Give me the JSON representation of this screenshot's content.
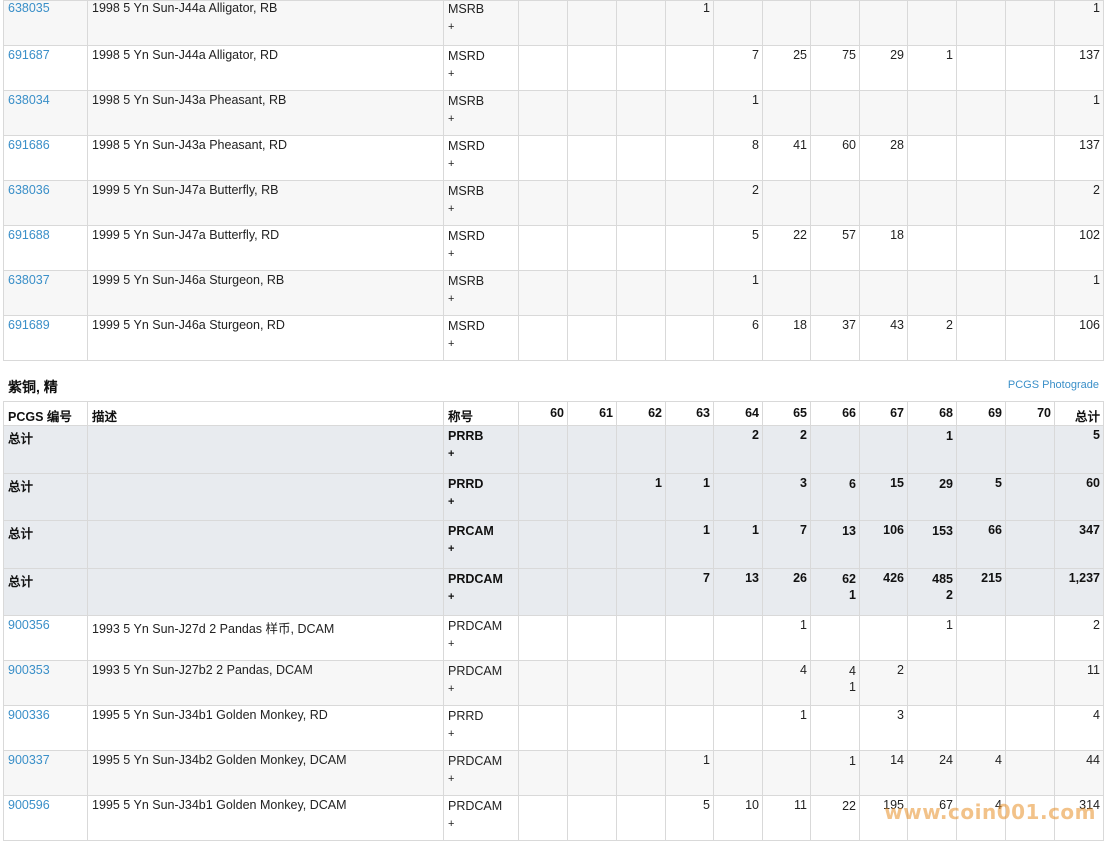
{
  "top_table": {
    "rows": [
      {
        "pcgs": "638035",
        "desc": "1998 5 Yn Sun-J44a Alligator, RB",
        "des": "MSRB",
        "plus": "+",
        "g60": "",
        "g61": "",
        "g62": "",
        "g63": "1",
        "g64": "",
        "g65": "",
        "g66": "",
        "g67": "",
        "g68": "",
        "g69": "",
        "g70": "",
        "total": "1"
      },
      {
        "pcgs": "691687",
        "desc": "1998 5 Yn Sun-J44a Alligator, RD",
        "des": "MSRD",
        "plus": "+",
        "g60": "",
        "g61": "",
        "g62": "",
        "g63": "",
        "g64": "7",
        "g65": "25",
        "g66": "75",
        "g67": "29",
        "g68": "1",
        "g69": "",
        "g70": "",
        "total": "137"
      },
      {
        "pcgs": "638034",
        "desc": "1998 5 Yn Sun-J43a Pheasant, RB",
        "des": "MSRB",
        "plus": "+",
        "g60": "",
        "g61": "",
        "g62": "",
        "g63": "",
        "g64": "1",
        "g65": "",
        "g66": "",
        "g67": "",
        "g68": "",
        "g69": "",
        "g70": "",
        "total": "1"
      },
      {
        "pcgs": "691686",
        "desc": "1998 5 Yn Sun-J43a Pheasant, RD",
        "des": "MSRD",
        "plus": "+",
        "g60": "",
        "g61": "",
        "g62": "",
        "g63": "",
        "g64": "8",
        "g65": "41",
        "g66": "60",
        "g67": "28",
        "g68": "",
        "g69": "",
        "g70": "",
        "total": "137"
      },
      {
        "pcgs": "638036",
        "desc": "1999 5 Yn Sun-J47a Butterfly, RB",
        "des": "MSRB",
        "plus": "+",
        "g60": "",
        "g61": "",
        "g62": "",
        "g63": "",
        "g64": "2",
        "g65": "",
        "g66": "",
        "g67": "",
        "g68": "",
        "g69": "",
        "g70": "",
        "total": "2"
      },
      {
        "pcgs": "691688",
        "desc": "1999 5 Yn Sun-J47a Butterfly, RD",
        "des": "MSRD",
        "plus": "+",
        "g60": "",
        "g61": "",
        "g62": "",
        "g63": "",
        "g64": "5",
        "g65": "22",
        "g66": "57",
        "g67": "18",
        "g68": "",
        "g69": "",
        "g70": "",
        "total": "102"
      },
      {
        "pcgs": "638037",
        "desc": "1999 5 Yn Sun-J46a Sturgeon, RB",
        "des": "MSRB",
        "plus": "+",
        "g60": "",
        "g61": "",
        "g62": "",
        "g63": "",
        "g64": "1",
        "g65": "",
        "g66": "",
        "g67": "",
        "g68": "",
        "g69": "",
        "g70": "",
        "total": "1"
      },
      {
        "pcgs": "691689",
        "desc": "1999 5 Yn Sun-J46a Sturgeon, RD",
        "des": "MSRD",
        "plus": "+",
        "g60": "",
        "g61": "",
        "g62": "",
        "g63": "",
        "g64": "6",
        "g65": "18",
        "g66": "37",
        "g67": "43",
        "g68": "2",
        "g69": "",
        "g70": "",
        "total": "106"
      }
    ]
  },
  "section": {
    "title": "紫铜, 精",
    "photograde_link": "PCGS Photograde"
  },
  "header": {
    "pcgs": "PCGS 编号",
    "desc": "描述",
    "des": "称号",
    "g60": "60",
    "g61": "61",
    "g62": "62",
    "g63": "63",
    "g64": "64",
    "g65": "65",
    "g66": "66",
    "g67": "67",
    "g68": "68",
    "g69": "69",
    "g70": "70",
    "total": "总计"
  },
  "totals": [
    {
      "label": "总计",
      "des": "PRRB",
      "plus": "+",
      "g60": "",
      "g61": "",
      "g62": "",
      "g63": "",
      "g64": "2",
      "g65": "2",
      "g66": "",
      "g66b": "",
      "g67": "",
      "g68": "1",
      "g68b": "",
      "g69": "",
      "g70": "",
      "total": "5"
    },
    {
      "label": "总计",
      "des": "PRRD",
      "plus": "+",
      "g60": "",
      "g61": "",
      "g62": "1",
      "g63": "1",
      "g64": "",
      "g65": "3",
      "g66": "6",
      "g66b": "",
      "g67": "15",
      "g68": "29",
      "g68b": "",
      "g69": "5",
      "g70": "",
      "total": "60"
    },
    {
      "label": "总计",
      "des": "PRCAM",
      "plus": "+",
      "g60": "",
      "g61": "",
      "g62": "",
      "g63": "1",
      "g64": "1",
      "g65": "7",
      "g66": "13",
      "g66b": "",
      "g67": "106",
      "g68": "153",
      "g68b": "",
      "g69": "66",
      "g70": "",
      "total": "347"
    },
    {
      "label": "总计",
      "des": "PRDCAM",
      "plus": "+",
      "g60": "",
      "g61": "",
      "g62": "",
      "g63": "7",
      "g64": "13",
      "g65": "26",
      "g66": "62",
      "g66b": "1",
      "g67": "426",
      "g68": "485",
      "g68b": "2",
      "g69": "215",
      "g70": "",
      "total": "1,237"
    }
  ],
  "bottom_rows": [
    {
      "pcgs": "900356",
      "desc": "1993 5 Yn Sun-J27d 2 Pandas 样币, DCAM",
      "des": "PRDCAM",
      "plus": "+",
      "g60": "",
      "g61": "",
      "g62": "",
      "g63": "",
      "g64": "",
      "g65": "1",
      "g66": "",
      "g66b": "",
      "g67": "",
      "g68": "1",
      "g69": "",
      "g70": "",
      "total": "2"
    },
    {
      "pcgs": "900353",
      "desc": "1993 5 Yn Sun-J27b2 2 Pandas, DCAM",
      "des": "PRDCAM",
      "plus": "+",
      "g60": "",
      "g61": "",
      "g62": "",
      "g63": "",
      "g64": "",
      "g65": "4",
      "g66": "4",
      "g66b": "1",
      "g67": "2",
      "g68": "",
      "g69": "",
      "g70": "",
      "total": "11"
    },
    {
      "pcgs": "900336",
      "desc": "1995 5 Yn Sun-J34b1 Golden Monkey, RD",
      "des": "PRRD",
      "plus": "+",
      "g60": "",
      "g61": "",
      "g62": "",
      "g63": "",
      "g64": "",
      "g65": "1",
      "g66": "",
      "g66b": "",
      "g67": "3",
      "g68": "",
      "g69": "",
      "g70": "",
      "total": "4"
    },
    {
      "pcgs": "900337",
      "desc": "1995 5 Yn Sun-J34b2 Golden Monkey, DCAM",
      "des": "PRDCAM",
      "plus": "+",
      "g60": "",
      "g61": "",
      "g62": "",
      "g63": "1",
      "g64": "",
      "g65": "",
      "g66": "1",
      "g66b": "",
      "g67": "14",
      "g68": "24",
      "g69": "4",
      "g70": "",
      "total": "44"
    },
    {
      "pcgs": "900596",
      "desc": "1995 5 Yn Sun-J34b1 Golden Monkey, DCAM",
      "des": "PRDCAM",
      "plus": "+",
      "g60": "",
      "g61": "",
      "g62": "",
      "g63": "5",
      "g64": "10",
      "g65": "11",
      "g66": "22",
      "g66b": "",
      "g67": "195",
      "g68": "67",
      "g69": "4",
      "g70": "",
      "total": "314"
    }
  ],
  "watermark": "www.coin001.com"
}
